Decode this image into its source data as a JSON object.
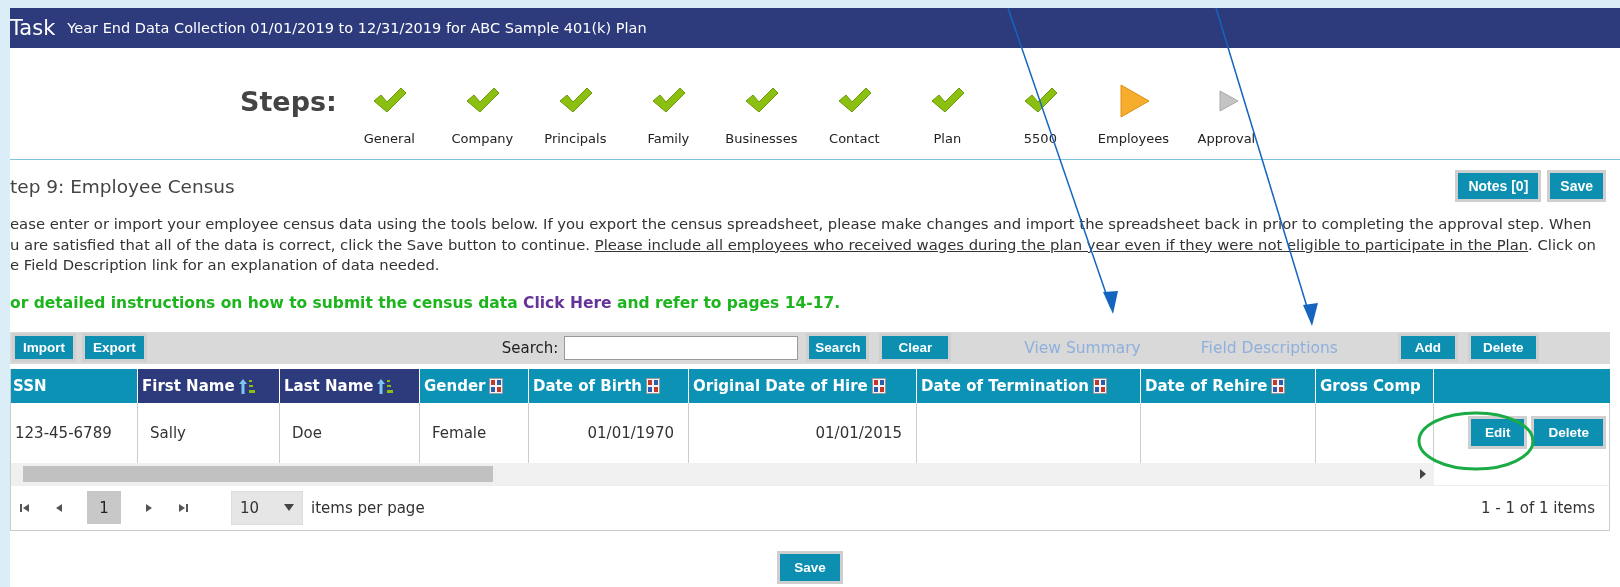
{
  "header": {
    "label": "Task",
    "title": "Year End Data Collection 01/01/2019 to 12/31/2019 for ABC Sample 401(k) Plan"
  },
  "steps_label": "Steps:",
  "steps": [
    {
      "label": "General",
      "kind": "done"
    },
    {
      "label": "Company",
      "kind": "done"
    },
    {
      "label": "Principals",
      "kind": "done"
    },
    {
      "label": "Family",
      "kind": "done"
    },
    {
      "label": "Businesses",
      "kind": "done"
    },
    {
      "label": "Contact",
      "kind": "done"
    },
    {
      "label": "Plan",
      "kind": "done"
    },
    {
      "label": "5500",
      "kind": "done"
    },
    {
      "label": "Employees",
      "kind": "current"
    },
    {
      "label": "Approval",
      "kind": "pending"
    }
  ],
  "section": {
    "heading": "tep 9: Employee Census",
    "buttons": [
      "Notes [0]",
      "Save"
    ],
    "intro": [
      {
        "text": "ease enter or import your employee census data using the tools below. If you export the census spreadsheet, please make changes and import the spreadsheet back in prior to completing the approval step. When"
      },
      {
        "text": "u are satisfied that all of the data is correct, click the Save button to continue. ",
        "underlined": "Please include all employees who received wages during the plan year even if they were not eligible to participate in the Plan",
        "after": ". Click on"
      },
      {
        "text": "e Field Description link for an explanation of data needed."
      }
    ],
    "instructions": {
      "before": "or detailed instructions on how to submit the census data ",
      "link": "Click Here",
      "after": " and refer to pages 14-17."
    }
  },
  "toolbar": [
    {
      "kind": "button",
      "label": "Import"
    },
    {
      "kind": "button",
      "label": "Export"
    },
    {
      "kind": "label",
      "label": "Search:"
    },
    {
      "kind": "input"
    },
    {
      "kind": "button",
      "label": "Search"
    },
    {
      "kind": "button",
      "label": "Clear"
    },
    {
      "kind": "link",
      "label": "View Summary"
    },
    {
      "kind": "link",
      "label": "Field Descriptions"
    },
    {
      "kind": "button",
      "label": "Add"
    },
    {
      "kind": "button",
      "label": "Delete"
    }
  ],
  "table": {
    "columns": [
      {
        "label": "SSN",
        "kind": "plain"
      },
      {
        "label": "First Name",
        "kind": "sorted"
      },
      {
        "label": "Last Name",
        "kind": "sorted"
      },
      {
        "label": "Gender",
        "kind": "sortable"
      },
      {
        "label": "Date of Birth",
        "kind": "sortable"
      },
      {
        "label": "Original Date of Hire",
        "kind": "sortable"
      },
      {
        "label": "Date of Termination",
        "kind": "sortable"
      },
      {
        "label": "Date of Rehire",
        "kind": "sortable"
      },
      {
        "label": "Gross Comp",
        "kind": "plain"
      },
      {
        "kind": "actions"
      }
    ],
    "rows": [
      {
        "cells": [
          "123-45-6789",
          "Sally",
          "Doe",
          "Female",
          "01/01/1970",
          "01/01/2015"
        ],
        "actions": [
          "Edit",
          "Delete"
        ]
      }
    ]
  },
  "pager": {
    "pages": [
      {
        "label": "1",
        "selected": true
      }
    ],
    "page_size": "10",
    "page_size_label": "items per page",
    "summary": "1 - 1 of 1 items"
  },
  "footer_button": "Save"
}
